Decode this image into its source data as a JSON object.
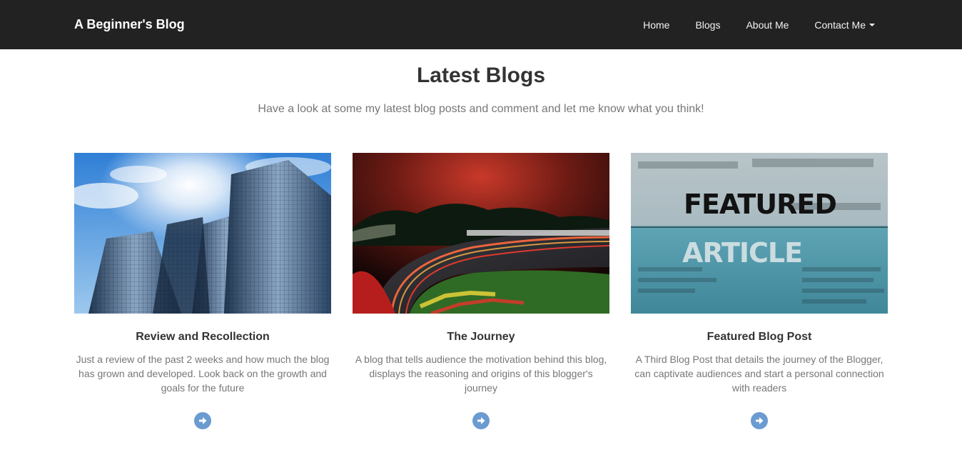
{
  "navbar": {
    "brand": "A Beginner's Blog",
    "links": [
      {
        "label": "Home"
      },
      {
        "label": "Blogs"
      },
      {
        "label": "About Me"
      },
      {
        "label": "Contact Me",
        "dropdown": true
      }
    ],
    "background_color": "#222222"
  },
  "header": {
    "title": "Latest Blogs",
    "subtitle": "Have a look at some my latest blog posts and comment and let me know what you think!"
  },
  "posts": [
    {
      "title": "Review and Recollection",
      "description": "Just a review of the past 2 weeks and how much the blog has grown and developed. Look back on the growth and goals for the future",
      "image_icon": "skyscrapers-image",
      "button_icon": "arrow-circle-right-icon"
    },
    {
      "title": "The Journey",
      "description": "A blog that tells audience the motivation behind this blog, displays the reasoning and origins of this blogger's journey",
      "image_icon": "race-track-night-image",
      "button_icon": "arrow-circle-right-icon"
    },
    {
      "title": "Featured Blog Post",
      "description": "A Third Blog Post that details the journey of the Blogger, can captivate audiences and start a personal connection with readers",
      "image_icon": "featured-article-image",
      "image_text": {
        "line1": "FEATURED",
        "line2": "ARTICLE"
      },
      "button_icon": "arrow-circle-right-icon"
    }
  ],
  "colors": {
    "accent": "#6a9bd1",
    "text_dark": "#333333",
    "text_muted": "#777777"
  }
}
